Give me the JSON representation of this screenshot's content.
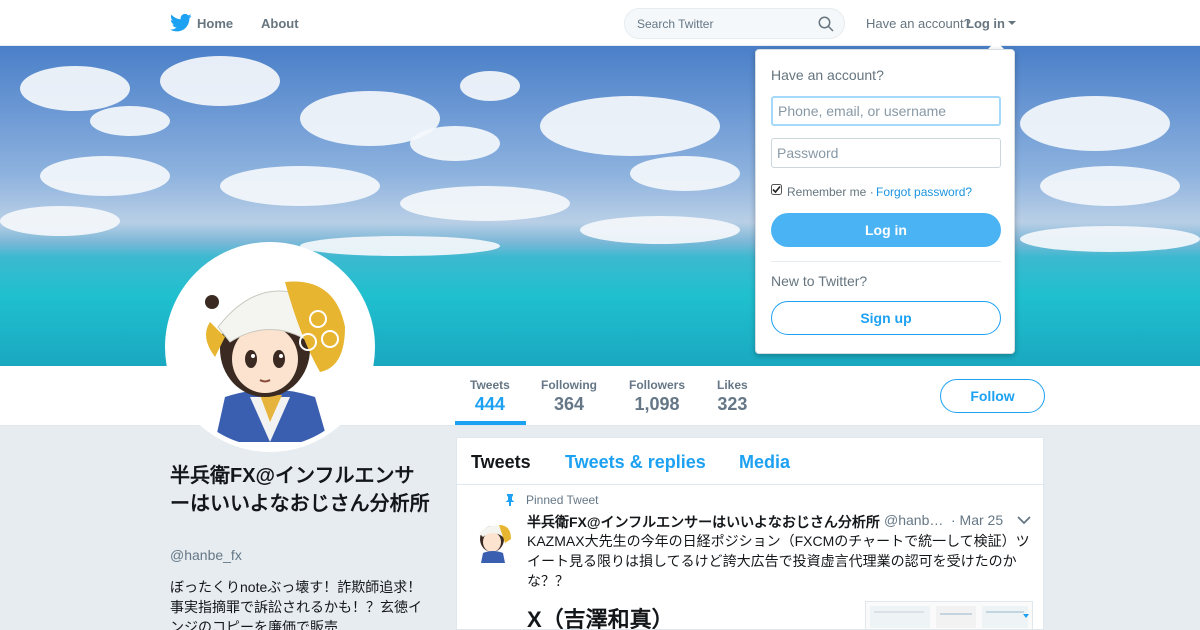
{
  "nav": {
    "logo_icon": "twitter-bird-icon",
    "home_label": "Home",
    "about_label": "About",
    "search_placeholder": "Search Twitter",
    "have_account": "Have an account?",
    "login_label": "Log in"
  },
  "stats": [
    {
      "label": "Tweets",
      "value": "444"
    },
    {
      "label": "Following",
      "value": "364"
    },
    {
      "label": "Followers",
      "value": "1,098"
    },
    {
      "label": "Likes",
      "value": "323"
    }
  ],
  "follow_label": "Follow",
  "profile": {
    "name": "半兵衛FX@インフルエンサーはいいよなおじさん分析所",
    "handle": "@hanbe_fx",
    "bio": "ぼったくりnoteぶっ壊す！詐欺師追求！事実指摘罪で訴訟されるかも！？玄徳インジのコピーを廉価で販売"
  },
  "timeline": {
    "tabs": [
      "Tweets",
      "Tweets & replies",
      "Media"
    ],
    "pinned_label": "Pinned Tweet",
    "tweet": {
      "name": "半兵衛FX@インフルエンサーはいいよなおじさん分析所",
      "handle": "@hanbe_fx",
      "date": "· Mar 25",
      "text": "KAZMAX大先生の今年の日経ポジション（FXCMのチャートで統一して検証）ツイート見る限りは損してるけど誇大広告で投資虚言代理業の認可を受けたのかな？？",
      "media_caption": "X（吉澤和真）"
    }
  },
  "login_dropdown": {
    "title": "Have an account?",
    "username_placeholder": "Phone, email, or username",
    "password_placeholder": "Password",
    "remember_label": "Remember me ·",
    "forgot_label": "Forgot password?",
    "login_button": "Log in",
    "new_label": "New to Twitter?",
    "signup_button": "Sign up"
  },
  "colors": {
    "accent": "#1da1f2",
    "login_button": "#4ab3f4",
    "background": "#e6ecf0"
  }
}
